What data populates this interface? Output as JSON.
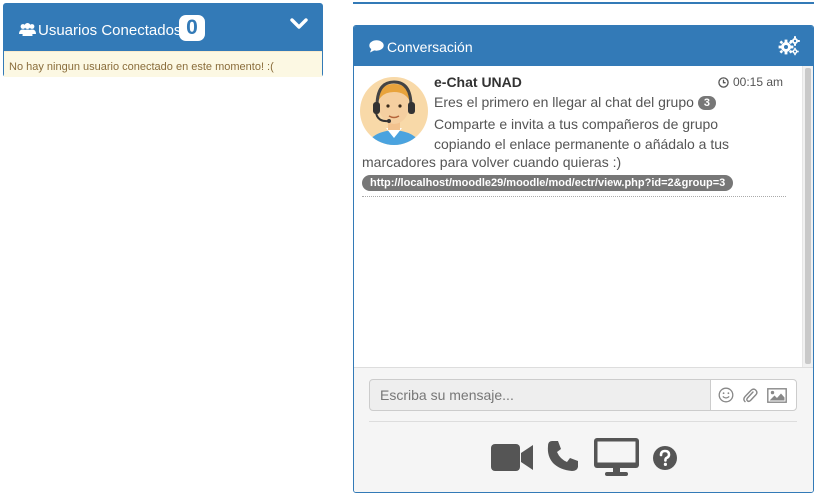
{
  "users_panel": {
    "title": "Usuarios Conectados",
    "count": "0",
    "empty_message": "No hay ningun usuario conectado en este momento! :("
  },
  "conversation": {
    "title": "Conversación",
    "message": {
      "sender": "e-Chat UNAD",
      "time": "00:15 am",
      "line1": "Eres el primero en llegar al chat del grupo",
      "group_number": "3",
      "line2": "Comparte e invita a tus compañeros de grupo copiando el enlace permanente o añádalo a tus",
      "line3": "marcadores para volver cuando quieras :)",
      "link": "http://localhost/moodle29/moodle/mod/ectr/view.php?id=2&group=3"
    },
    "input": {
      "placeholder": "Escriba su mensaje..."
    }
  },
  "colors": {
    "primary": "#337ab7",
    "warning_bg": "#fcf8e3",
    "warning_text": "#8a6d3b",
    "badge_gray": "#777777",
    "tool_icon": "#555555"
  },
  "icons": [
    "users-icon",
    "chevron-down-icon",
    "comment-icon",
    "gears-icon",
    "clock-icon",
    "smiley-icon",
    "paperclip-icon",
    "image-icon",
    "video-camera-icon",
    "phone-icon",
    "desktop-icon",
    "help-icon"
  ]
}
